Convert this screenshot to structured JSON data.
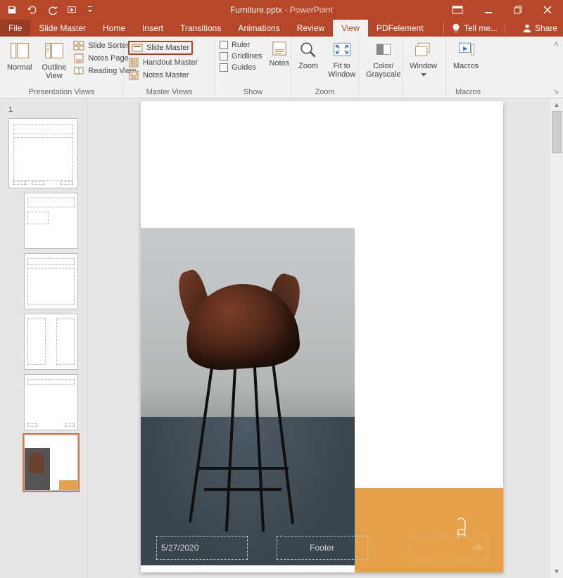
{
  "title": {
    "filename": "Furniture.pptx",
    "app": "PowerPoint"
  },
  "window": {
    "restore": "Restore",
    "minimize": "Minimize",
    "close": "Close"
  },
  "tabs": {
    "file": "File",
    "slidemaster": "Slide Master",
    "home": "Home",
    "insert": "Insert",
    "transitions": "Transitions",
    "animations": "Animations",
    "review": "Review",
    "view": "View",
    "pdfelement": "PDFelement",
    "tellme": "Tell me...",
    "share": "Share"
  },
  "ribbon": {
    "presentation_views": {
      "label": "Presentation Views",
      "normal": "Normal",
      "outline": "Outline\nView",
      "sorter": "Slide Sorter",
      "notes": "Notes Page",
      "reading": "Reading View"
    },
    "master_views": {
      "label": "Master Views",
      "slide": "Slide Master",
      "handout": "Handout Master",
      "notesm": "Notes Master"
    },
    "show": {
      "label": "Show",
      "ruler": "Ruler",
      "gridlines": "Gridlines",
      "guides": "Guides",
      "notesbtn": "Notes"
    },
    "zoom": {
      "label": "Zoom",
      "zoom": "Zoom",
      "fit": "Fit to\nWindow"
    },
    "color": {
      "label": "",
      "btn": "Color/\nGrayscale"
    },
    "window": {
      "label": "",
      "btn": "Window"
    },
    "macros": {
      "label": "Macros",
      "btn": "Macros"
    }
  },
  "thumb_number": "1",
  "placeholders": {
    "date": "5/27/2020",
    "footer": "Footer",
    "slidenum": "‹#›"
  }
}
